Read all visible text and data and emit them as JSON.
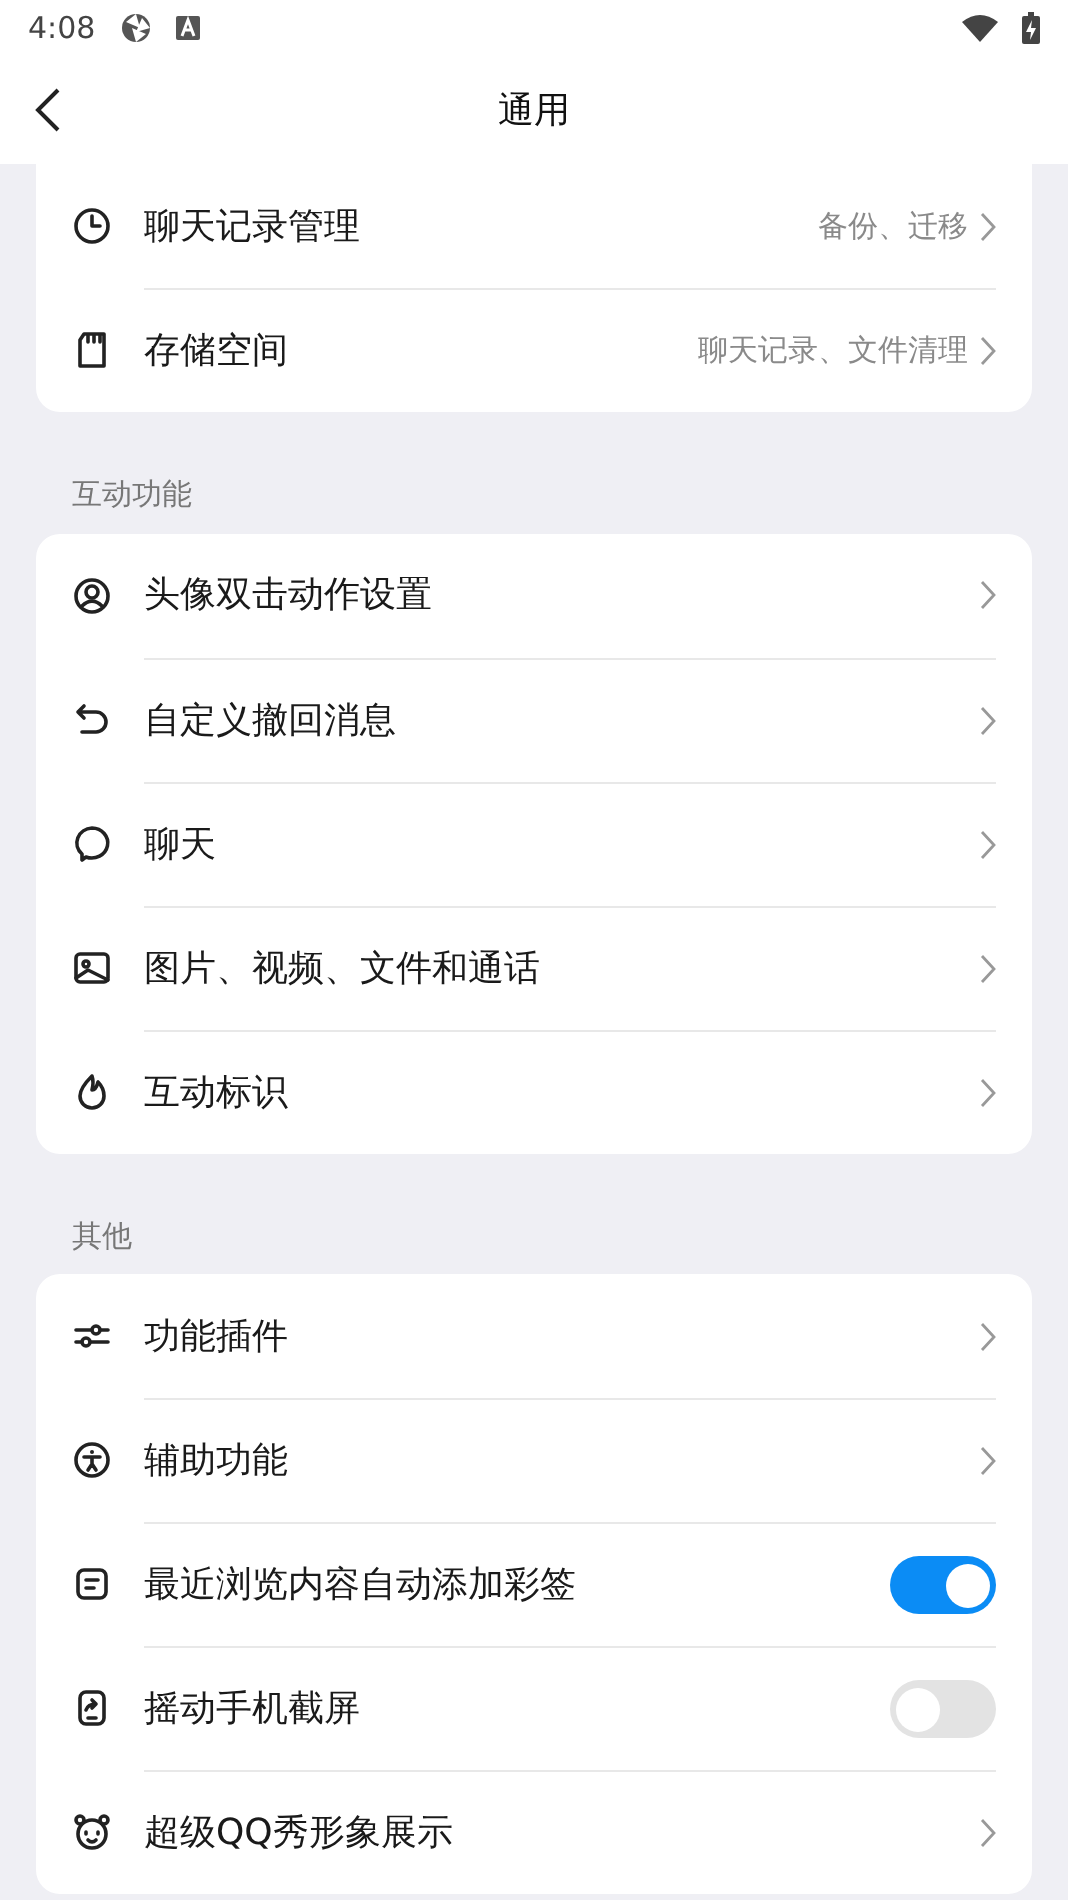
{
  "status_bar": {
    "time": "4:08"
  },
  "header": {
    "title": "通用"
  },
  "sections": [
    {
      "items": [
        {
          "kind": "link",
          "label": "聊天记录管理",
          "value": "备份、迁移"
        },
        {
          "kind": "link",
          "label": "存储空间",
          "value": "聊天记录、文件清理"
        }
      ]
    },
    {
      "heading": "互动功能",
      "items": [
        {
          "kind": "link",
          "label": "头像双击动作设置"
        },
        {
          "kind": "link",
          "label": "自定义撤回消息"
        },
        {
          "kind": "link",
          "label": "聊天"
        },
        {
          "kind": "link",
          "label": "图片、视频、文件和通话"
        },
        {
          "kind": "link",
          "label": "互动标识"
        }
      ]
    },
    {
      "heading": "其他",
      "items": [
        {
          "kind": "link",
          "label": "功能插件"
        },
        {
          "kind": "link",
          "label": "辅助功能"
        },
        {
          "kind": "toggle",
          "label": "最近浏览内容自动添加彩签",
          "on": true
        },
        {
          "kind": "toggle",
          "label": "摇动手机截屏",
          "on": false
        },
        {
          "kind": "link",
          "label": "超级QQ秀形象展示"
        }
      ]
    }
  ]
}
